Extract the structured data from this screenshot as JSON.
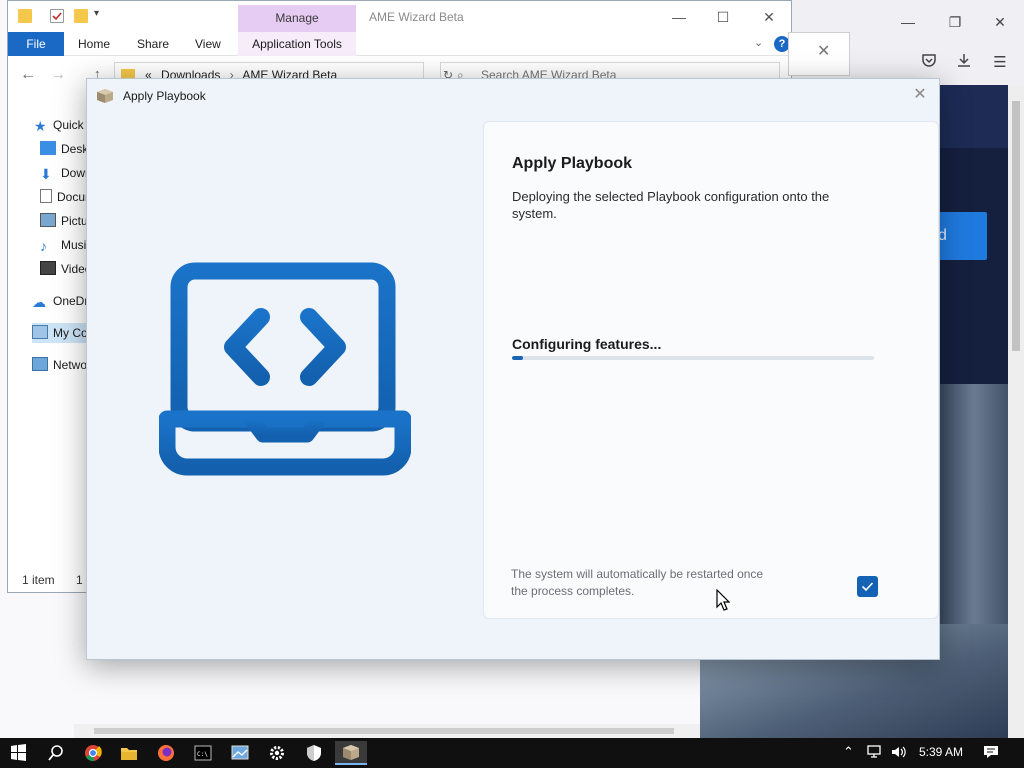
{
  "explorer": {
    "manage_tab": "Manage",
    "title": "AME Wizard Beta",
    "ribbon_tabs": [
      "File",
      "Home",
      "Share",
      "View",
      "Application Tools"
    ],
    "address_path": [
      "«",
      "Downloads",
      "›",
      "AME Wizard Beta"
    ],
    "search_placeholder": "Search AME Wizard Beta",
    "nav_items": [
      "Quick access",
      "Desktop",
      "Downloads",
      "Documents",
      "Pictures",
      "Music",
      "Videos",
      "OneDrive",
      "My Computer",
      "Network"
    ],
    "status_items": "1 item",
    "status_selected": "1"
  },
  "browser": {
    "page_button_fragment": "d"
  },
  "dialog": {
    "title": "Apply Playbook",
    "heading": "Apply Playbook",
    "description": "Deploying the selected Playbook configuration onto the system.",
    "status": "Configuring features...",
    "progress": 0.03,
    "restart_note": "The system will automatically be restarted once the process completes.",
    "restart_checked": true,
    "accent": "#1462b4"
  },
  "taskbar": {
    "clock": "5:39 AM",
    "apps": [
      "start-icon",
      "search-icon",
      "chrome-icon",
      "file-explorer-icon",
      "firefox-icon",
      "cmd-icon",
      "control-panel-icon",
      "settings-icon",
      "security-icon",
      "ame-wizard-icon"
    ]
  }
}
